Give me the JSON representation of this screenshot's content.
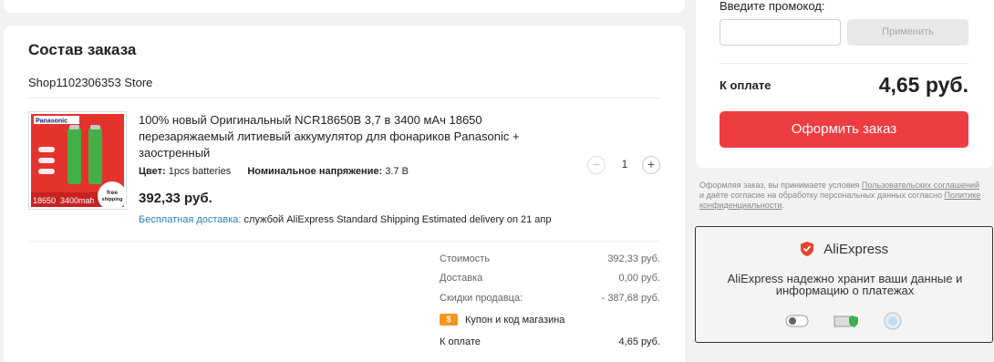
{
  "order": {
    "title": "Состав заказа",
    "store": "Shop1102306353 Store",
    "item": {
      "title": "100% новый Оригинальный NCR18650B 3,7 в 3400 мАч 18650 перезаряжаемый литиевый аккумулятор для фонариков Panasonic + заостренный",
      "color_label": "Цвет:",
      "color_value": "1pcs batteries",
      "voltage_label": "Номинальное напряжение:",
      "voltage_value": "3.7 В",
      "price": "392,33 руб.",
      "free_shipping": "Бесплатная доставка:",
      "shipping_service": "службой AliExpress Standard Shipping",
      "delivery_estimate": "Estimated delivery on 21 апр",
      "quantity": "1",
      "image_text": {
        "brand": "Panasonic",
        "model": "18650",
        "capacity": "3400mah",
        "badge_top": "free",
        "badge_bottom": "shipping"
      }
    },
    "summary": {
      "cost_label": "Стоимость",
      "cost_value": "392,33 руб.",
      "delivery_label": "Доставка",
      "delivery_value": "0,00 руб.",
      "discount_label": "Скидки продавца:",
      "discount_value": "- 387,68 руб.",
      "coupon_label": "Купон и код магазина",
      "coupon_icon": "$",
      "total_label": "К оплате",
      "total_value": "4,65 руб."
    }
  },
  "checkout": {
    "promo_label": "Введите промокод:",
    "promo_placeholder": "",
    "apply_button": "Применить",
    "pay_label": "К оплате",
    "pay_value": "4,65 руб.",
    "order_button": "Оформить заказ",
    "terms_prefix": "Оформляя заказ, вы принимаете условия ",
    "terms_link1": "Пользовательских соглашений",
    "terms_middle": " и даёте согласие на обработку персональных данных согласно ",
    "terms_link2": "Политике конфиденциальности",
    "terms_suffix": "."
  },
  "security": {
    "brand": "AliExpress",
    "text": "AliExpress надежно хранит ваши данные и информацию о платежах"
  },
  "colors": {
    "accent_red": "#ee3d42",
    "link_blue": "#2a7fc1",
    "coupon_orange": "#f7941e"
  }
}
